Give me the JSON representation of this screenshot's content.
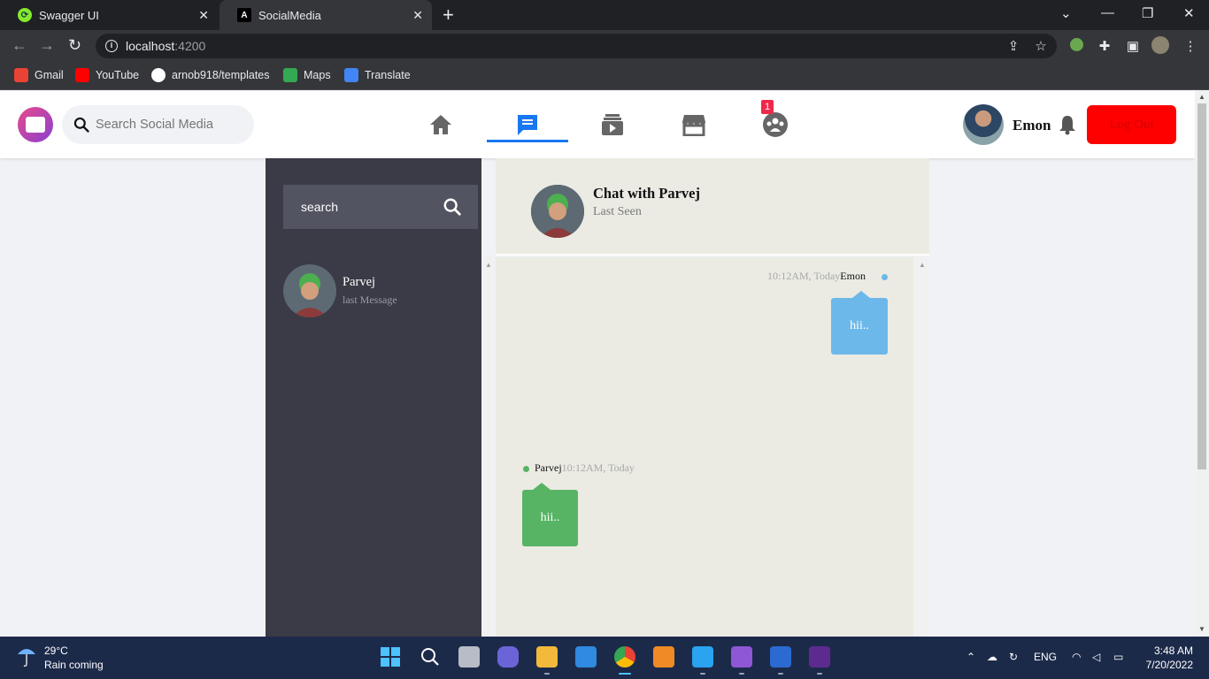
{
  "browser": {
    "tabs": [
      {
        "title": "Swagger UI",
        "icon": "swagger-icon"
      },
      {
        "title": "SocialMedia",
        "icon": "angular-icon",
        "active": true
      }
    ],
    "url_host": "localhost",
    "url_port": ":4200",
    "bookmarks": [
      {
        "label": "Gmail",
        "icon": "gmail-icon",
        "color": "#ea4335"
      },
      {
        "label": "YouTube",
        "icon": "youtube-icon",
        "color": "#ff0000"
      },
      {
        "label": "arnob918/templates",
        "icon": "github-icon",
        "color": "#ffffff"
      },
      {
        "label": "Maps",
        "icon": "maps-icon",
        "color": "#34a853"
      },
      {
        "label": "Translate",
        "icon": "translate-icon",
        "color": "#4285f4"
      }
    ]
  },
  "header": {
    "search_placeholder": "Search Social Media",
    "nav": [
      {
        "name": "home",
        "icon": "home-icon",
        "active": false
      },
      {
        "name": "messages",
        "icon": "message-icon",
        "active": true
      },
      {
        "name": "watch",
        "icon": "video-icon",
        "active": false
      },
      {
        "name": "marketplace",
        "icon": "store-icon",
        "active": false
      },
      {
        "name": "groups",
        "icon": "groups-icon",
        "active": false,
        "badge": "1"
      }
    ],
    "user_name": "Emon",
    "logout_label": "Log Out",
    "accent_color": "#1877f2",
    "logout_color": "#ff0000"
  },
  "chat": {
    "search_placeholder": "search",
    "contacts": [
      {
        "name": "Parvej",
        "last": "last Message"
      }
    ],
    "header_title": "Chat with Parvej",
    "header_sub": "Last Seen",
    "messages": [
      {
        "side": "me",
        "time": "10:12AM, Today",
        "sender": "Emon",
        "text": "hii..",
        "color": "#6cb8ea"
      },
      {
        "side": "them",
        "time": "10:12AM, Today",
        "sender": "Parvej",
        "text": "hii..",
        "color": "#57b464"
      }
    ]
  },
  "taskbar": {
    "temperature": "29°C",
    "weather": "Rain coming",
    "language": "ENG",
    "time": "3:48 AM",
    "date": "7/20/2022"
  }
}
